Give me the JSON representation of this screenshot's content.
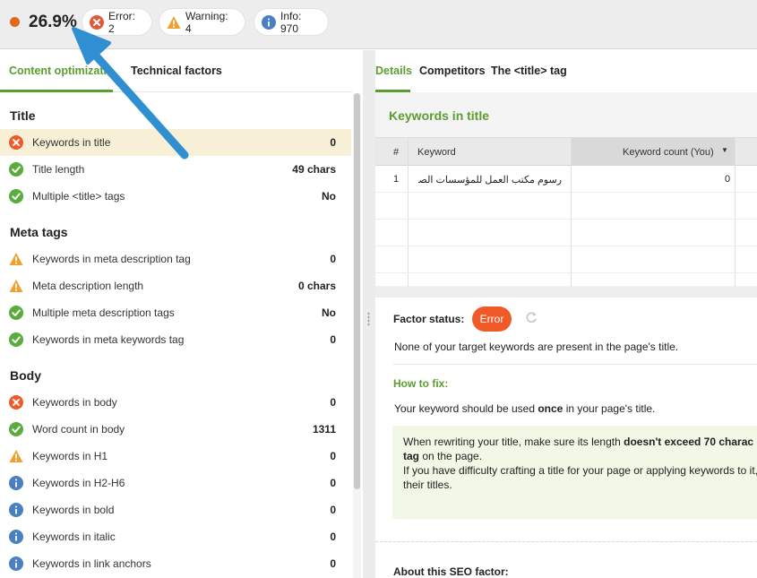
{
  "header": {
    "score": "26.9%",
    "score_color": "#e06a1c",
    "error_label": "Error: 2",
    "warning_label": "Warning: 4",
    "info_label": "Info: 970"
  },
  "left_tabs": {
    "content": "Content optimization",
    "technical": "Technical factors"
  },
  "groups": {
    "title": {
      "heading": "Title",
      "rows": [
        {
          "label": "Keywords in title",
          "value": "0",
          "status": "error"
        },
        {
          "label": "Title length",
          "value": "49 chars",
          "status": "ok"
        },
        {
          "label": "Multiple <title> tags",
          "value": "No",
          "status": "ok"
        }
      ]
    },
    "meta": {
      "heading": "Meta tags",
      "rows": [
        {
          "label": "Keywords in meta description tag",
          "value": "0",
          "status": "warning"
        },
        {
          "label": "Meta description length",
          "value": "0 chars",
          "status": "warning"
        },
        {
          "label": "Multiple meta description tags",
          "value": "No",
          "status": "ok"
        },
        {
          "label": "Keywords in meta keywords tag",
          "value": "0",
          "status": "ok"
        }
      ]
    },
    "body": {
      "heading": "Body",
      "rows": [
        {
          "label": "Keywords in body",
          "value": "0",
          "status": "error"
        },
        {
          "label": "Word count in body",
          "value": "1311",
          "status": "ok"
        },
        {
          "label": "Keywords in H1",
          "value": "0",
          "status": "warning"
        },
        {
          "label": "Keywords in H2-H6",
          "value": "0",
          "status": "info"
        },
        {
          "label": "Keywords in bold",
          "value": "0",
          "status": "info"
        },
        {
          "label": "Keywords in italic",
          "value": "0",
          "status": "info"
        },
        {
          "label": "Keywords in link anchors",
          "value": "0",
          "status": "info"
        }
      ]
    }
  },
  "right_tabs": {
    "details": "Details",
    "competitors": "Competitors",
    "title_tag": "The <title> tag"
  },
  "keywords_panel": {
    "title": "Keywords in title",
    "col_num": "#",
    "col_keyword": "Keyword",
    "col_count": "Keyword count (You)",
    "rows": [
      {
        "num": "1",
        "keyword": "رسوم مكتب العمل للمؤسسات الصغيرة ...",
        "count": "0"
      }
    ]
  },
  "factor": {
    "status_label": "Factor status:",
    "status_value": "Error",
    "status_text": "None of your target keywords are present in the page's title.",
    "howto_label": "How to fix:",
    "howto_pre": "Your keyword should be used ",
    "howto_bold": "once",
    "howto_post": " in your page's title.",
    "tip_line1_pre": "When rewriting your title, make sure its length ",
    "tip_line1_bold": "doesn't exceed 70 charac",
    "tip_line2_bold": "tag",
    "tip_line2_post": " on the page.",
    "tip_line3": "If you have difficulty crafting a title for your page or applying keywords to it,",
    "tip_line4": "their titles.",
    "about_label": "About this SEO factor:"
  },
  "colors": {
    "accent_green": "#5a9e2f",
    "error_red": "#f05a28",
    "warning_orange": "#f0a030",
    "info_blue": "#4a7fc1",
    "ok_green": "#5aac3c",
    "arrow_blue": "#2f8fd0"
  }
}
